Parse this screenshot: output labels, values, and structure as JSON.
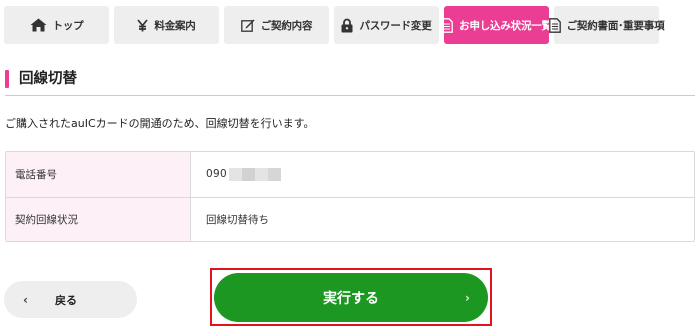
{
  "nav": {
    "tabs": [
      {
        "label": "トップ",
        "icon": "home-icon",
        "active": false
      },
      {
        "label": "料金案内",
        "icon": "yen-icon",
        "active": false
      },
      {
        "label": "ご契約内容",
        "icon": "edit-icon",
        "active": false
      },
      {
        "label": "パスワード変更",
        "icon": "lock-icon",
        "active": false
      },
      {
        "label": "お申し込み状況一覧",
        "icon": "document-icon",
        "active": true
      },
      {
        "label": "ご契約書面･重要事項",
        "icon": "document-icon",
        "active": false
      }
    ]
  },
  "page": {
    "title": "回線切替",
    "description": "ご購入されたauICカードの開通のため、回線切替を行います。"
  },
  "info": {
    "rows": [
      {
        "label": "電話番号",
        "value": "090"
      },
      {
        "label": "契約回線状況",
        "value": "回線切替待ち"
      }
    ]
  },
  "buttons": {
    "back_label": "戻る",
    "back_icon": "chevron-left-icon",
    "submit_label": "実行する",
    "submit_icon": "chevron-right-icon"
  },
  "colors": {
    "accent": "#eb3d93",
    "primary": "#1b9722",
    "highlight": "#e0141e",
    "label_bg": "#fdf0f6"
  }
}
